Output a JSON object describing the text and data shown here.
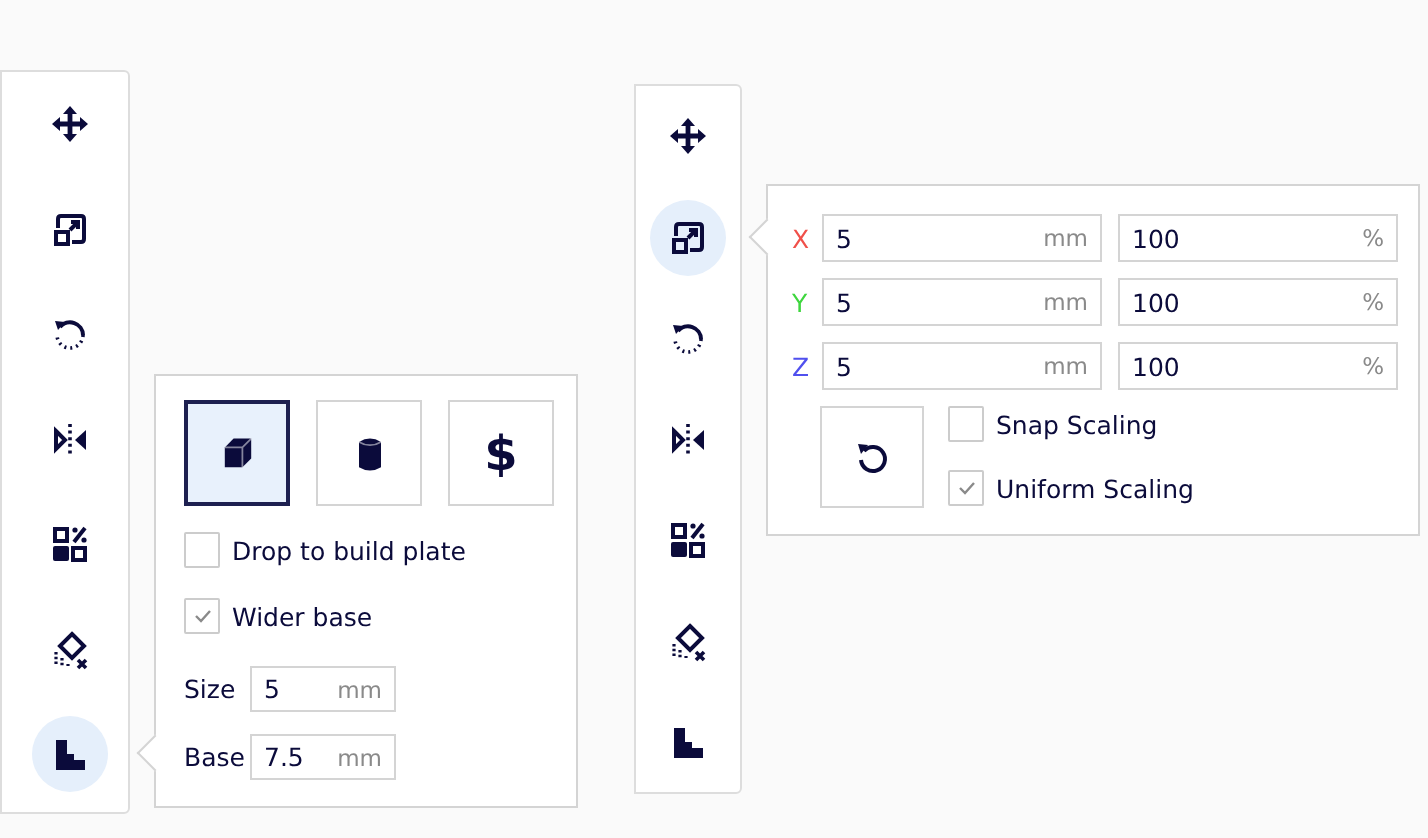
{
  "left_toolbar": {
    "tools": [
      {
        "kind": "move",
        "selected": false
      },
      {
        "kind": "scale",
        "selected": false
      },
      {
        "kind": "rotate",
        "selected": false
      },
      {
        "kind": "mirror",
        "selected": false
      },
      {
        "kind": "arrange",
        "selected": false
      },
      {
        "kind": "blocker",
        "selected": false
      },
      {
        "kind": "support",
        "selected": true
      }
    ]
  },
  "support_panel": {
    "modes": [
      {
        "kind": "cube",
        "selected": true
      },
      {
        "kind": "cylinder",
        "selected": false
      },
      {
        "kind": "custom",
        "glyph": "$",
        "selected": false
      }
    ],
    "checkboxes": [
      {
        "label": "Drop to build plate",
        "checked": false
      },
      {
        "label": "Wider base",
        "checked": true
      }
    ],
    "fields": [
      {
        "label": "Size",
        "value": "5",
        "unit": "mm"
      },
      {
        "label": "Base",
        "value": "7.5",
        "unit": "mm"
      }
    ]
  },
  "right_toolbar": {
    "tools": [
      {
        "kind": "move",
        "selected": false
      },
      {
        "kind": "scale",
        "selected": true
      },
      {
        "kind": "rotate",
        "selected": false
      },
      {
        "kind": "mirror",
        "selected": false
      },
      {
        "kind": "arrange",
        "selected": false
      },
      {
        "kind": "blocker",
        "selected": false
      },
      {
        "kind": "support",
        "selected": false
      }
    ]
  },
  "scale_panel": {
    "axes": [
      {
        "axis": "X",
        "color": "#f0504a",
        "size": "5",
        "size_unit": "mm",
        "percent": "100",
        "percent_unit": "%"
      },
      {
        "axis": "Y",
        "color": "#3ed63e",
        "size": "5",
        "size_unit": "mm",
        "percent": "100",
        "percent_unit": "%"
      },
      {
        "axis": "Z",
        "color": "#5050ee",
        "size": "5",
        "size_unit": "mm",
        "percent": "100",
        "percent_unit": "%"
      }
    ],
    "checkboxes": [
      {
        "label": "Snap Scaling",
        "checked": false
      },
      {
        "label": "Uniform Scaling",
        "checked": true
      }
    ]
  }
}
